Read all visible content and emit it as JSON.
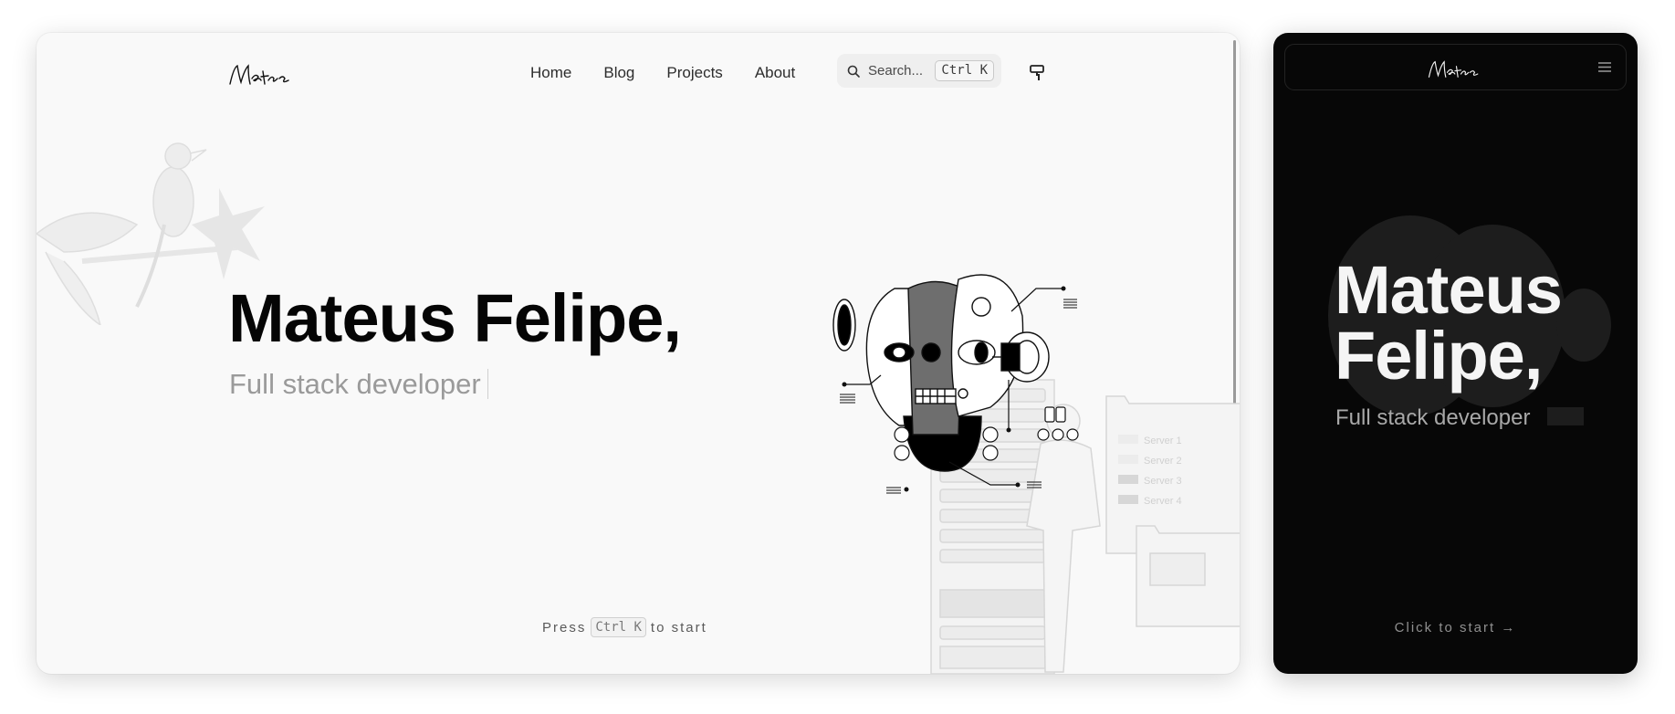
{
  "desktop": {
    "logo_text": "Mateus",
    "nav": {
      "items": [
        {
          "label": "Home"
        },
        {
          "label": "Blog"
        },
        {
          "label": "Projects"
        },
        {
          "label": "About"
        }
      ]
    },
    "search": {
      "placeholder": "Search...",
      "shortcut": "Ctrl K",
      "icon": "search-icon"
    },
    "theme_icon": "paint-roller-icon",
    "hero": {
      "title": "Mateus Felipe,",
      "subtitle": "Full stack developer"
    },
    "illustration": {
      "server_labels": [
        "Server 1",
        "Server 2",
        "Server 3",
        "Server 4"
      ]
    },
    "press": {
      "before": "Press",
      "key": "Ctrl K",
      "after": "to start"
    }
  },
  "mobile": {
    "logo_text": "Mateus",
    "menu_icon": "hamburger-menu-icon",
    "hero": {
      "title": "Mateus Felipe,",
      "subtitle": "Full stack developer"
    },
    "start": "Click to start →"
  },
  "colors": {
    "desktop_bg": "#f9f9f9",
    "mobile_bg": "#070707",
    "title_dark": "#050505",
    "subtitle_gray": "#9a9a9a"
  }
}
